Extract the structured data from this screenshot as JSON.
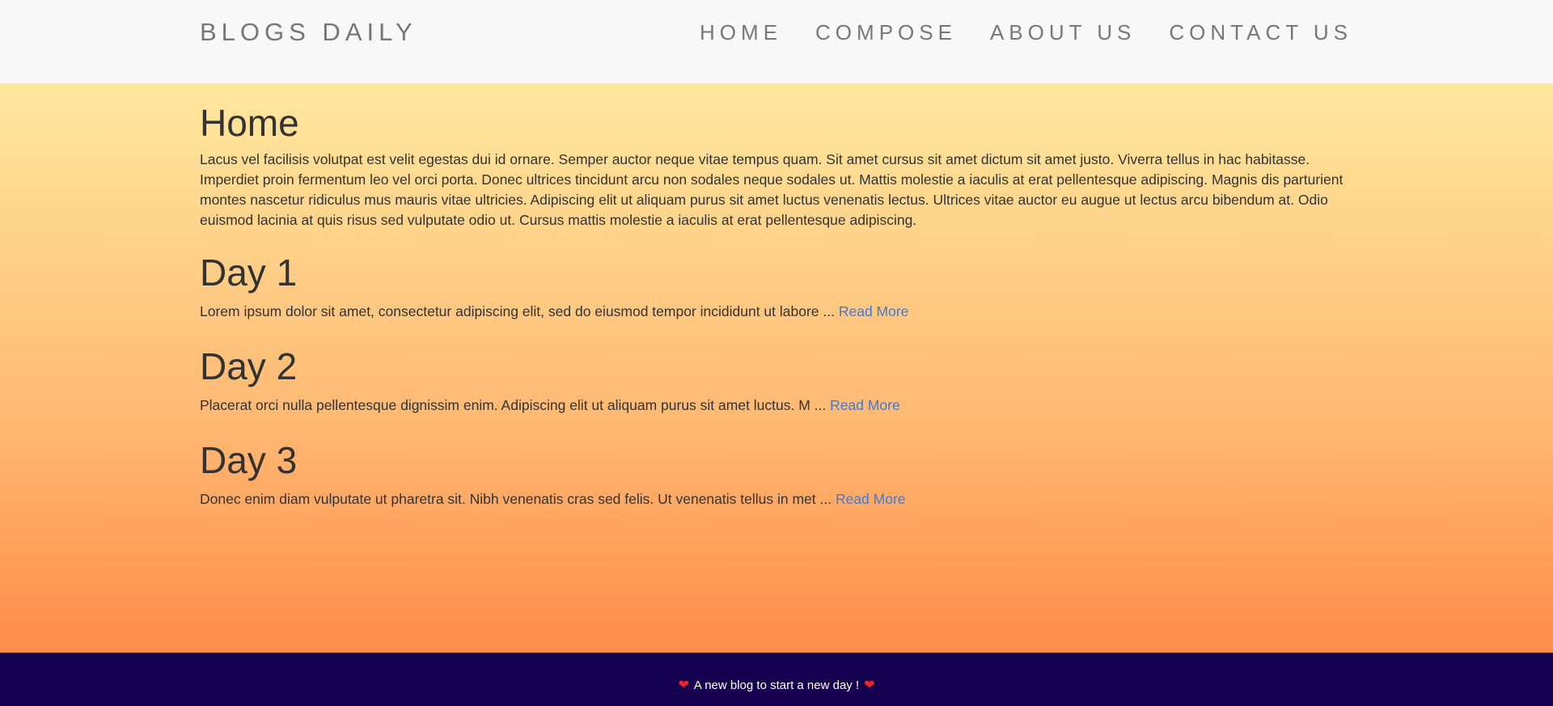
{
  "navbar": {
    "brand": "BLOGS DAILY",
    "links": [
      {
        "label": "HOME"
      },
      {
        "label": "COMPOSE"
      },
      {
        "label": "ABOUT US"
      },
      {
        "label": "CONTACT US"
      }
    ]
  },
  "main": {
    "title": "Home",
    "intro": "Lacus vel facilisis volutpat est velit egestas dui id ornare. Semper auctor neque vitae tempus quam. Sit amet cursus sit amet dictum sit amet justo. Viverra tellus in hac habitasse. Imperdiet proin fermentum leo vel orci porta. Donec ultrices tincidunt arcu non sodales neque sodales ut. Mattis molestie a iaculis at erat pellentesque adipiscing. Magnis dis parturient montes nascetur ridiculus mus mauris vitae ultricies. Adipiscing elit ut aliquam purus sit amet luctus venenatis lectus. Ultrices vitae auctor eu augue ut lectus arcu bibendum at. Odio euismod lacinia at quis risus sed vulputate odio ut. Cursus mattis molestie a iaculis at erat pellentesque adipiscing.",
    "posts": [
      {
        "title": "Day 1",
        "excerpt": "Lorem ipsum dolor sit amet, consectetur adipiscing elit, sed do eiusmod tempor incididunt ut labore ... ",
        "link": "Read More"
      },
      {
        "title": "Day 2",
        "excerpt": "Placerat orci nulla pellentesque dignissim enim. Adipiscing elit ut aliquam purus sit amet luctus. M ... ",
        "link": "Read More"
      },
      {
        "title": "Day 3",
        "excerpt": "Donec enim diam vulputate ut pharetra sit. Nibh venenatis cras sed felis. Ut venenatis tellus in met ... ",
        "link": "Read More"
      }
    ]
  },
  "footer": {
    "text": "A new blog to start a new day !",
    "icon": "heart-icon",
    "icon_color": "#e8282a"
  },
  "colors": {
    "navbar_bg": "#f8f8f8",
    "footer_bg": "#150050",
    "link": "#3d7ad6",
    "gradient_top": "#ffe89e",
    "gradient_bottom": "#ff8c4a"
  }
}
